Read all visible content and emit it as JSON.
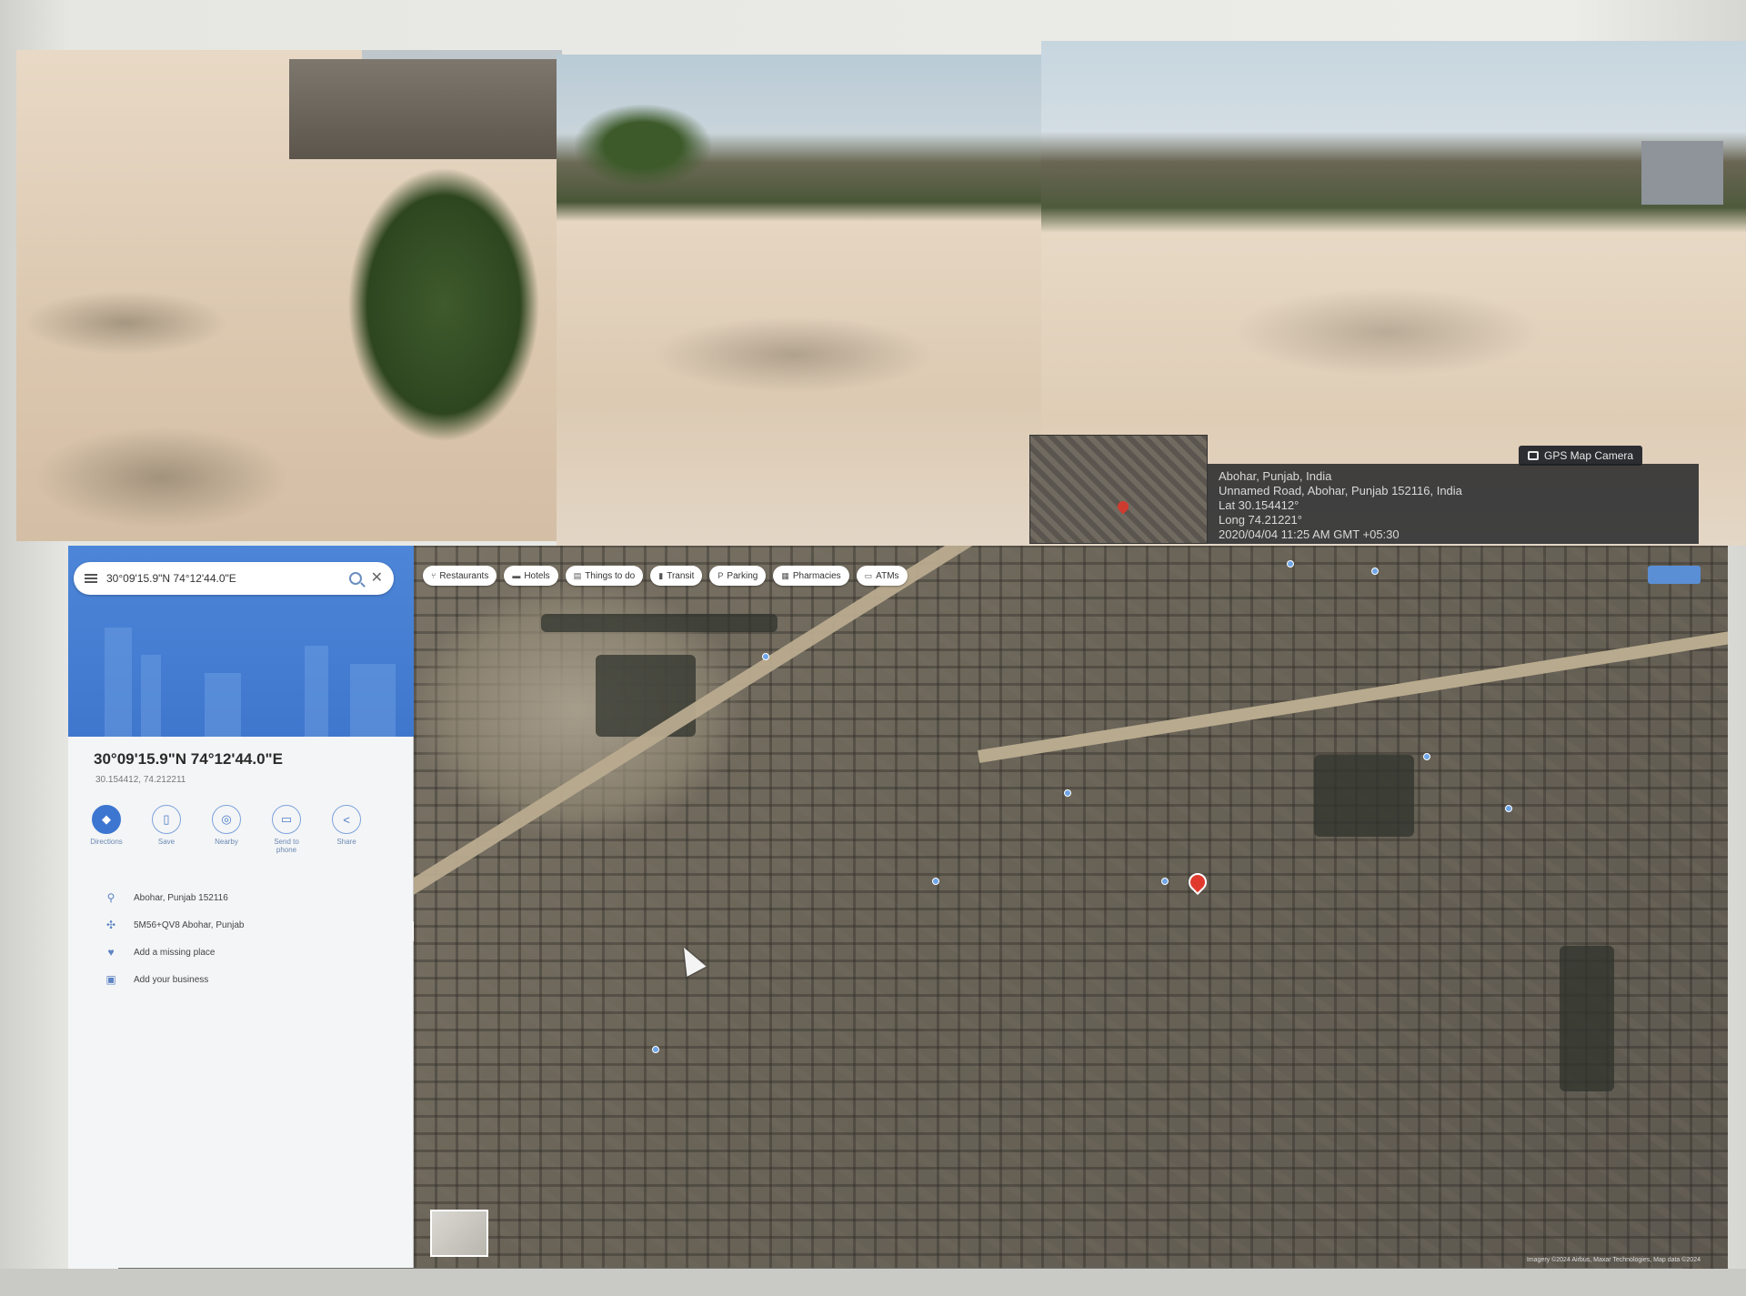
{
  "photo_stamp": {
    "badge_label": "GPS Map Camera",
    "lines": [
      "Abohar, Punjab, India",
      "Unnamed Road, Abohar, Punjab 152116, India",
      "Lat 30.154412°",
      "Long 74.21221°",
      "2020/04/04 11:25 AM GMT +05:30"
    ]
  },
  "maps": {
    "search_value": "30°09'15.9\"N 74°12'44.0\"E",
    "place_title": "30°09'15.9\"N 74°12'44.0\"E",
    "place_subtitle": "30.154412, 74.212211",
    "actions": [
      {
        "label": "Directions",
        "icon": "directions-icon"
      },
      {
        "label": "Save",
        "icon": "bookmark-icon"
      },
      {
        "label": "Nearby",
        "icon": "nearby-icon"
      },
      {
        "label": "Send to phone",
        "icon": "send-to-phone-icon"
      },
      {
        "label": "Share",
        "icon": "share-icon"
      }
    ],
    "info": [
      {
        "text": "Abohar, Punjab 152116",
        "icon": "location-pin-icon"
      },
      {
        "text": "5M56+QV8 Abohar, Punjab",
        "icon": "plus-code-icon"
      },
      {
        "text": "Add a missing place",
        "icon": "add-place-icon"
      },
      {
        "text": "Add your business",
        "icon": "business-icon"
      }
    ],
    "chips": [
      {
        "label": "Restaurants",
        "icon": "restaurant-icon"
      },
      {
        "label": "Hotels",
        "icon": "hotel-icon"
      },
      {
        "label": "Things to do",
        "icon": "things-to-do-icon"
      },
      {
        "label": "Transit",
        "icon": "transit-icon"
      },
      {
        "label": "Parking",
        "icon": "parking-icon"
      },
      {
        "label": "Pharmacies",
        "icon": "pharmacy-icon"
      },
      {
        "label": "ATMs",
        "icon": "atm-icon"
      }
    ],
    "footer": "Imagery ©2024 Airbus, Maxar Technologies, Map data ©2024"
  },
  "colors": {
    "accent": "#3d76d0",
    "pin": "#e03a2f"
  }
}
